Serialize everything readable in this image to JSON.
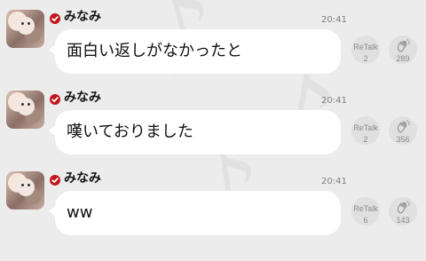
{
  "posts": [
    {
      "username": "みなみ",
      "time": "20:41",
      "text": "面白い返しがなかったと",
      "retalk": {
        "label": "ReTalk",
        "count": "2"
      },
      "claps": {
        "count": "289"
      }
    },
    {
      "username": "みなみ",
      "time": "20:41",
      "text": "嘆いておりました",
      "retalk": {
        "label": "ReTalk",
        "count": "2"
      },
      "claps": {
        "count": "356"
      }
    },
    {
      "username": "みなみ",
      "time": "20:41",
      "text": "ww",
      "retalk": {
        "label": "ReTalk",
        "count": "6"
      },
      "claps": {
        "count": "143"
      }
    }
  ],
  "colors": {
    "background": "#ececec",
    "bubble": "#ffffff",
    "verified_badge": "#c4161c",
    "button_bg": "#e0e0e0",
    "muted_text": "#8a8a8a"
  },
  "icons": {
    "verified": "check-badge-icon",
    "clap": "clap-hands-icon"
  }
}
